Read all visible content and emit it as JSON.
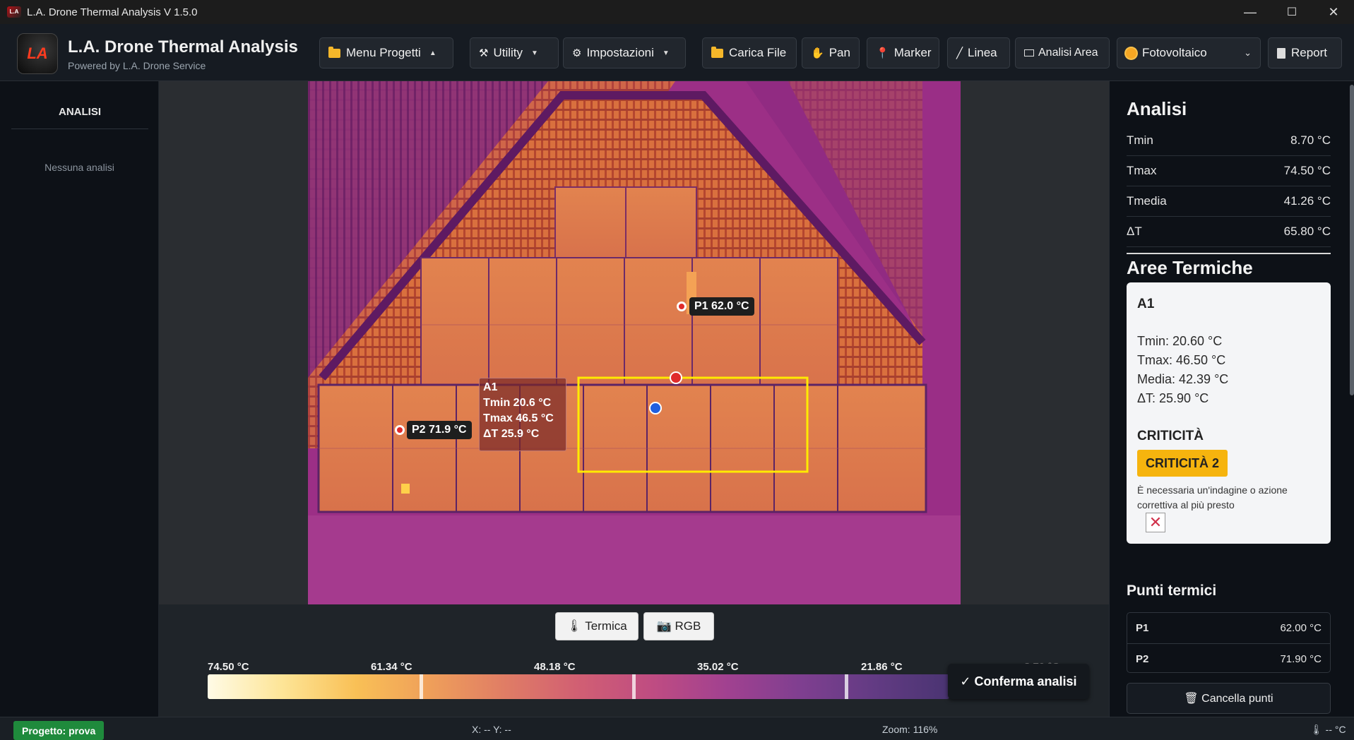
{
  "window": {
    "title": "L.A. Drone Thermal Analysis V 1.5.0",
    "minimize_glyph": "—",
    "maximize_glyph": "☐",
    "close_glyph": "✕"
  },
  "brand": {
    "logo_text": "LA",
    "title": "L.A. Drone Thermal Analysis",
    "subtitle": "Powered by L.A. Drone Service"
  },
  "toolbar": {
    "menu_progetti": "Menu Progetti",
    "utility": "Utility",
    "impostazioni": "Impostazioni",
    "carica_file": "Carica File",
    "pan": "Pan",
    "marker": "Marker",
    "linea": "Linea",
    "analisi_area": "Analisi Area",
    "mode_select": "Fotovoltaico",
    "report": "Report",
    "icons": {
      "utility": "⚒",
      "impostazioni": "⚙",
      "pan": "✋",
      "marker": "📍",
      "linea": "╱"
    }
  },
  "left_panel": {
    "heading": "ANALISI",
    "empty_text": "Nessuna analisi"
  },
  "overlays": {
    "p1": {
      "label": "P1  62.0 °C"
    },
    "p2": {
      "label": "P2  71.9 °C"
    },
    "a1": {
      "name": "A1",
      "tmin": "Tmin 20.6 °C",
      "tmax": "Tmax 46.5 °C",
      "dt": "ΔT 25.9 °C"
    }
  },
  "view_buttons": {
    "termica": "🌡 Termica",
    "rgb": "📷 RGB"
  },
  "colorbar": {
    "labels": [
      "74.50 °C",
      "61.34 °C",
      "48.18 °C",
      "35.02 °C",
      "21.86 °C",
      "8.70 °C"
    ]
  },
  "confirm_button": "✓ Conferma analisi",
  "analisi": {
    "title": "Analisi",
    "rows": [
      {
        "label": "Tmin",
        "value": "8.70 °C"
      },
      {
        "label": "Tmax",
        "value": "74.50 °C"
      },
      {
        "label": "Tmedia",
        "value": "41.26 °C"
      },
      {
        "label": "ΔT",
        "value": "65.80 °C"
      }
    ]
  },
  "aree_termiche": {
    "title": "Aree Termiche",
    "card": {
      "name": "A1",
      "tmin": "Tmin: 20.60 °C",
      "tmax": "Tmax: 46.50 °C",
      "media": "Media: 42.39 °C",
      "dt": "ΔT: 25.90 °C",
      "criticita_heading": "CRITICITÀ",
      "criticita_badge": "CRITICITÀ 2",
      "description": "È necessaria un'indagine o azione correttiva al più presto",
      "delete_glyph": "✕"
    }
  },
  "punti_termici": {
    "title": "Punti termici",
    "rows": [
      {
        "label": "P1",
        "value": "62.00 °C"
      },
      {
        "label": "P2",
        "value": "71.90 °C"
      }
    ],
    "clear_button": "🗑 Cancella punti"
  },
  "statusbar": {
    "project": "Progetto: prova",
    "coords": "X: -- Y: --",
    "zoom": "Zoom: 116%",
    "temp": "🌡 -- °C"
  },
  "colors": {
    "accent_marker_red": "#e02b2b",
    "area_yellow": "#ffea00",
    "criticita": "#f6b40e",
    "project_green": "#1f8a3c"
  }
}
